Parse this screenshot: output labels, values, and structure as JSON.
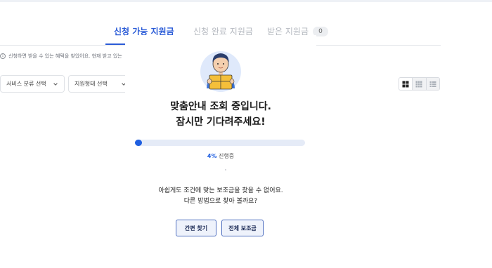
{
  "tabs": [
    {
      "label": "신청 가능 지원금",
      "count": "",
      "active": true
    },
    {
      "label": "신청 완료 지원금",
      "count": "",
      "active": false
    },
    {
      "label": "받은 지원금",
      "count": "0",
      "active": false
    }
  ],
  "info": {
    "icon": "info-icon",
    "text": "신청하면 받을 수 있는 혜택을 찾았어요. 현재 받고 있는"
  },
  "filters": [
    {
      "label": "서비스 분류 선택"
    },
    {
      "label": "지원형태 선택"
    }
  ],
  "view_toggle": {
    "selected": "card-view"
  },
  "loading": {
    "title_line1": "맞춤안내 조회 중입니다.",
    "title_line2": "잠시만 기다려주세요!",
    "progress_percent_label": "4%",
    "progress_suffix": "진행중",
    "progress": 0.04,
    "message_line1": "아쉽게도 조건에 맞는 보조금을 찾을 수 없어요.",
    "message_line2": "다른 방법으로 찾아 볼까요?",
    "buttons": {
      "simple_search": "간편 찾기",
      "all_subsidies": "전체 보조금"
    }
  },
  "colors": {
    "accent": "#1f5fe0",
    "track": "#e5ebf7",
    "button_border": "#4f6fbf",
    "button_bg": "#eef2fb"
  }
}
